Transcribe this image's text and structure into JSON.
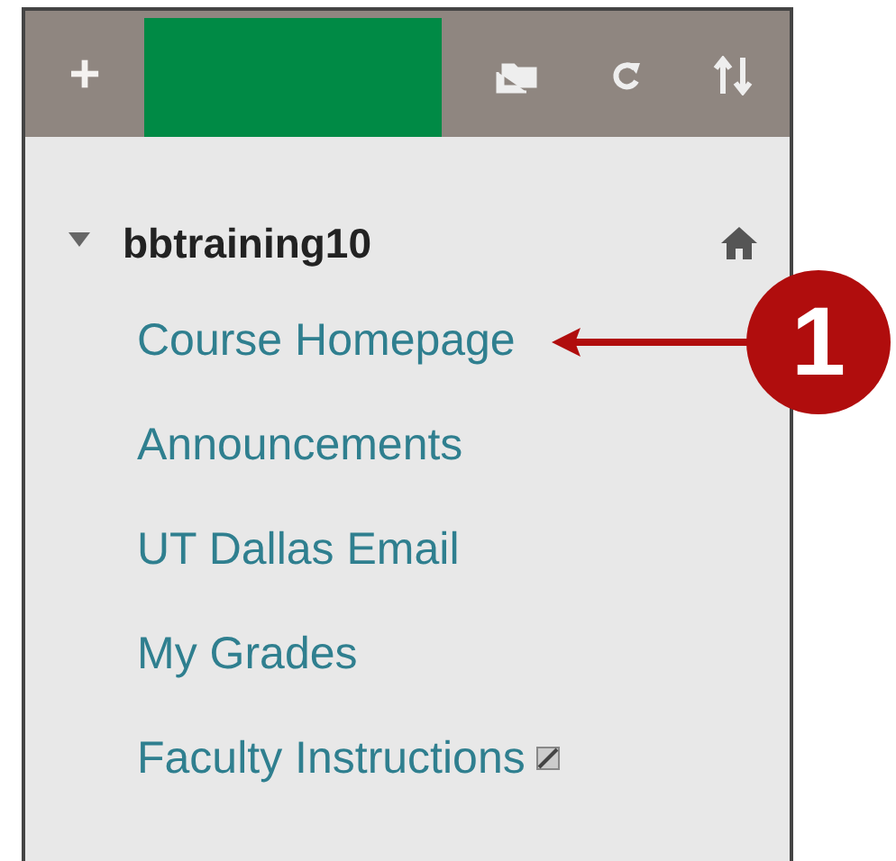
{
  "toolbar": {
    "add_label": "+"
  },
  "course": {
    "name": "bbtraining10",
    "expanded": true
  },
  "menu_items": [
    {
      "label": "Course Homepage",
      "restricted": false
    },
    {
      "label": "Announcements",
      "restricted": false
    },
    {
      "label": "UT Dallas Email",
      "restricted": false
    },
    {
      "label": "My Grades",
      "restricted": false
    },
    {
      "label": "Faculty Instructions",
      "restricted": true
    }
  ],
  "callout": {
    "label": "1"
  }
}
